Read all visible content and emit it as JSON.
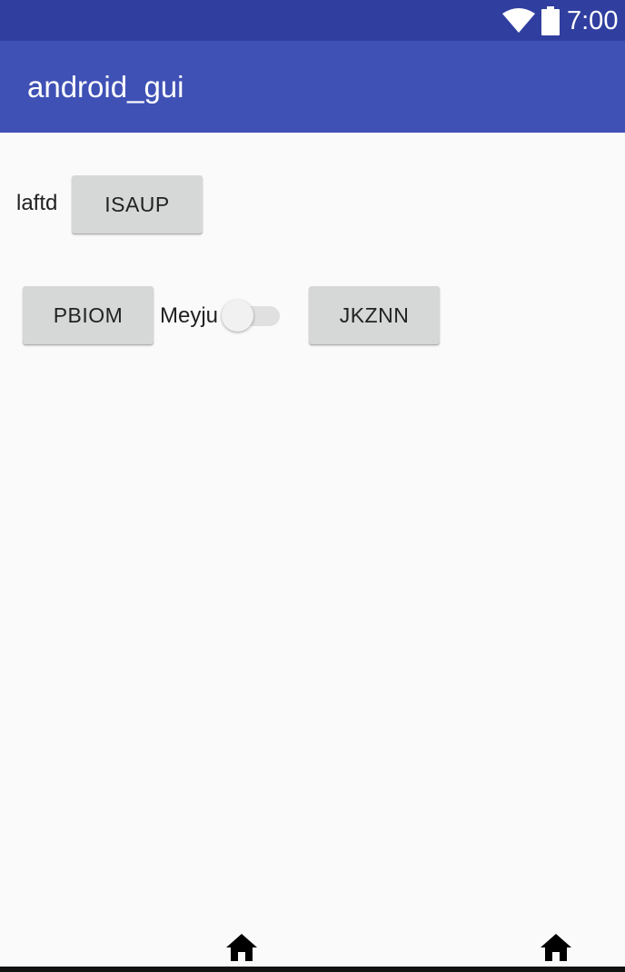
{
  "status_bar": {
    "time": "7:00",
    "icons": [
      "wifi-icon",
      "battery-icon"
    ],
    "background_color": "#303f9f"
  },
  "app_bar": {
    "title": "android_gui",
    "background_color": "#3f51b5"
  },
  "row1": {
    "label": "laftd",
    "button_label": "ISAUP"
  },
  "row2": {
    "left_button_label": "PBIOM",
    "switch_label": "Meyju",
    "switch_on": false,
    "right_button_label": "JKZNN"
  },
  "nav_bar": {
    "icons": [
      "home-icon",
      "home-icon"
    ]
  },
  "colors": {
    "background": "#fafafa",
    "button": "#d6d7d7",
    "text": "#212121"
  }
}
